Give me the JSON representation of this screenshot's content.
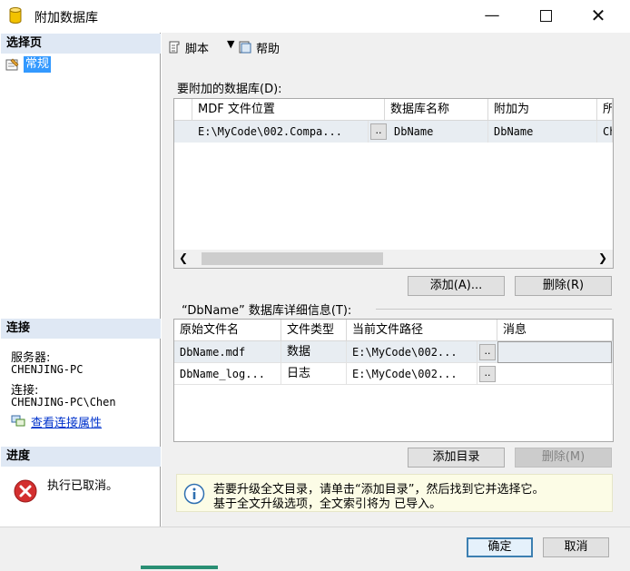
{
  "window": {
    "title": "附加数据库"
  },
  "left": {
    "select_page_header": "选择页",
    "pages": [
      {
        "label": "常规"
      }
    ],
    "connection_header": "连接",
    "server_label": "服务器:",
    "server_value": "CHENJING-PC",
    "connection_label": "连接:",
    "connection_value": "CHENJING-PC\\Chen",
    "view_props_link": "查看连接属性",
    "progress_header": "进度",
    "progress_status": "执行已取消。"
  },
  "toolbar": {
    "script_label": "脚本",
    "help_label": "帮助"
  },
  "attach": {
    "section_label": "要附加的数据库(D):",
    "columns": [
      "MDF 文件位置",
      "数据库名称",
      "附加为",
      "所"
    ],
    "rows": [
      {
        "mdf": "E:\\MyCode\\002.Compa...",
        "dbname": "DbName",
        "attach_as": "DbName",
        "owner": "Ch"
      }
    ],
    "add_button": "添加(A)...",
    "remove_button": "删除(R)"
  },
  "details": {
    "section_label": "“DbName” 数据库详细信息(T):",
    "columns": [
      "原始文件名",
      "文件类型",
      "当前文件路径",
      "消息"
    ],
    "rows": [
      {
        "file": "DbName.mdf",
        "type": "数据",
        "path": "E:\\MyCode\\002...",
        "msg": ""
      },
      {
        "file": "DbName_log...",
        "type": "日志",
        "path": "E:\\MyCode\\002...",
        "msg": ""
      }
    ],
    "add_catalog_button": "添加目录",
    "remove_button": "删除(M)"
  },
  "info": {
    "line1": "若要升级全文目录，请单击“添加目录”，然后找到它并选择它。",
    "line2": "基于全文升级选项，全文索引将为 已导入。"
  },
  "footer": {
    "ok_button": "确定",
    "cancel_button": "取消"
  },
  "colors": {
    "selected_item": "#3399ff",
    "header_band": "#dfe8f4",
    "error_red": "#d32f2f"
  }
}
